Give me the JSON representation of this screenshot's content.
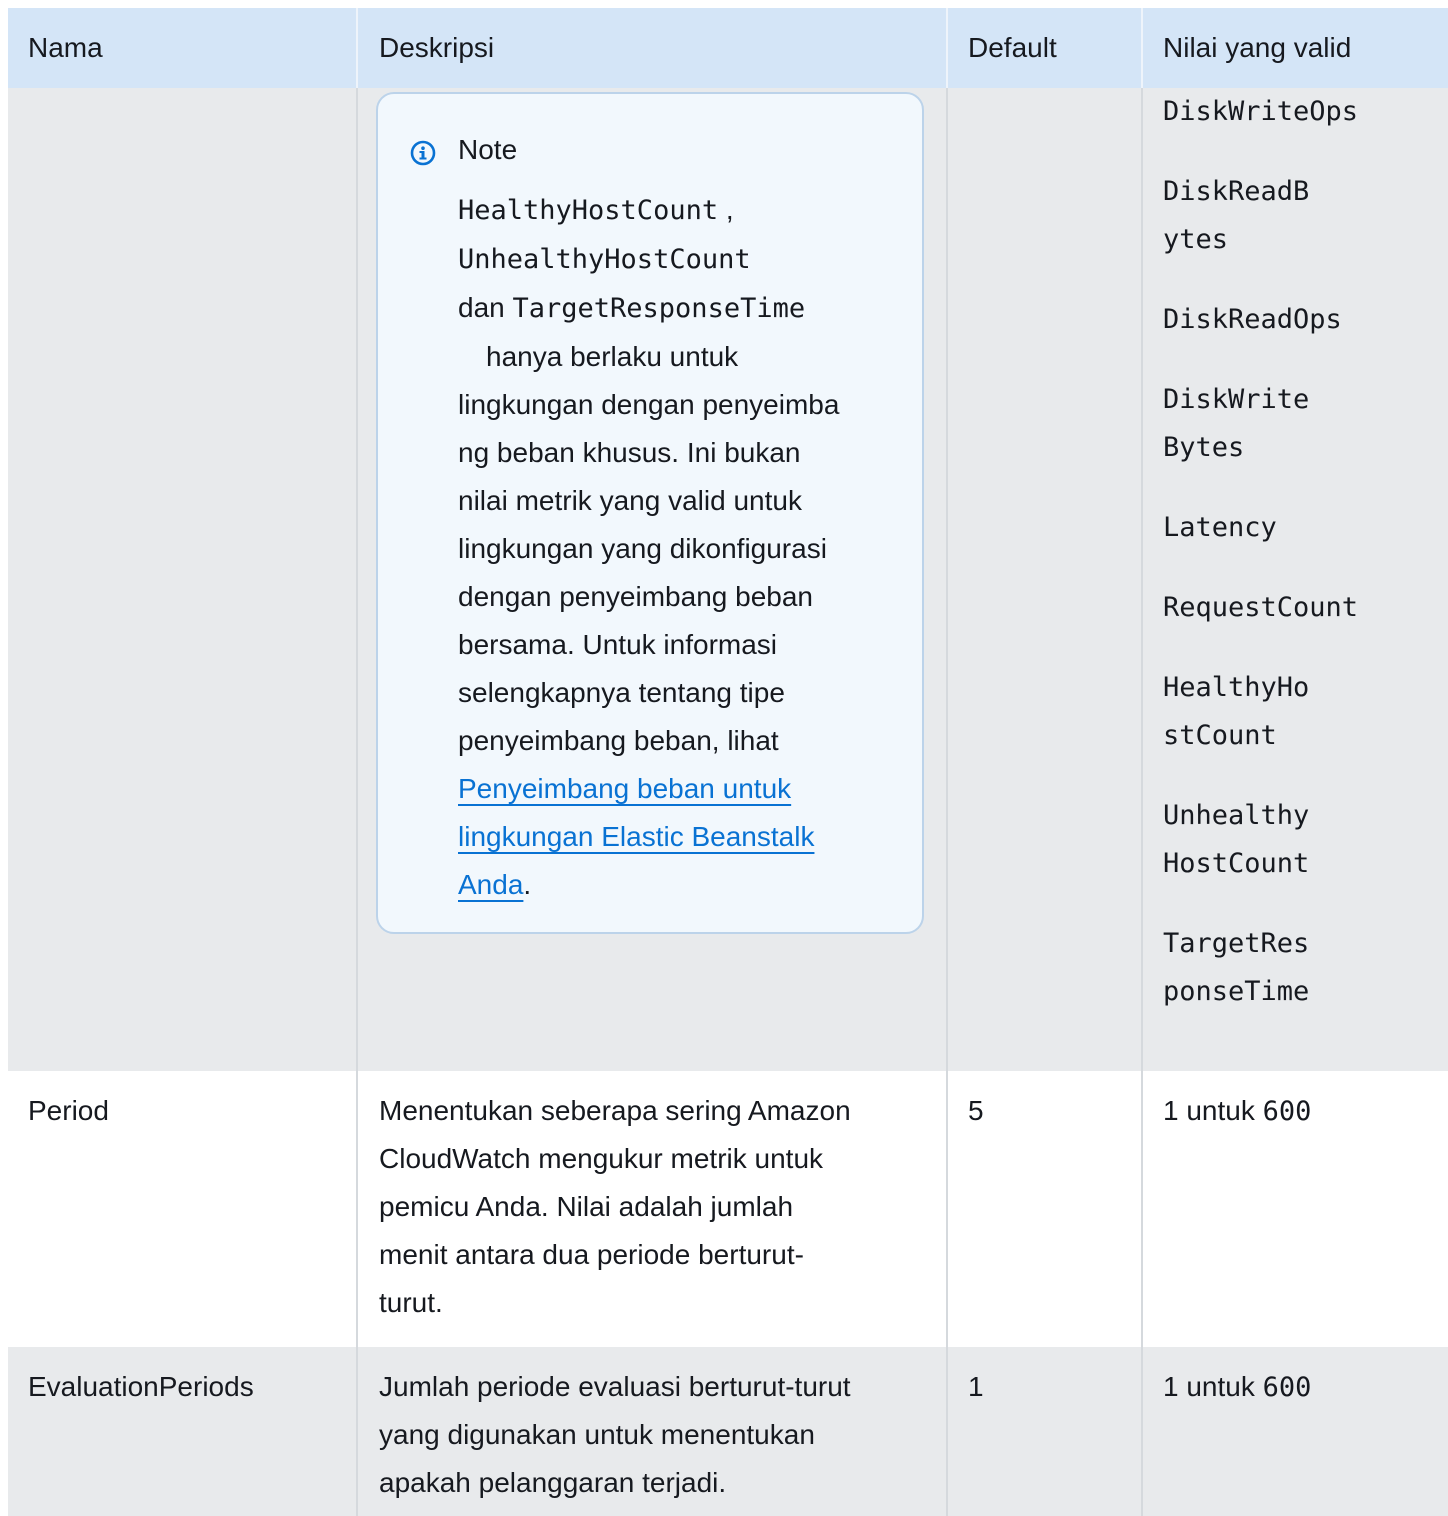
{
  "columns": {
    "name": "Nama",
    "description": "Deskripsi",
    "default": "Default",
    "valid": "Nilai yang valid"
  },
  "note": {
    "title": "Note",
    "code1": "HealthyHostCount",
    "sep1": " ,",
    "code2": "UnhealthyHostCount",
    "dan": "dan ",
    "code3": "TargetResponseTime",
    "lines": [
      "hanya berlaku untuk",
      "lingkungan dengan penyeimba",
      "ng beban khusus. Ini bukan",
      "nilai metrik yang valid untuk",
      "lingkungan yang dikonfigurasi",
      "dengan penyeimbang beban",
      "bersama. Untuk informasi",
      "selengkapnya tentang tipe",
      "penyeimbang beban, lihat"
    ],
    "link_lines": [
      "Penyeimbang beban untuk",
      "lingkungan Elastic Beanstalk",
      "Anda"
    ],
    "link_suffix": "."
  },
  "valid_values": [
    [
      "DiskWriteOps"
    ],
    [
      "DiskReadB",
      "ytes"
    ],
    [
      "DiskReadOps"
    ],
    [
      "DiskWrite",
      "Bytes"
    ],
    [
      "Latency"
    ],
    [
      "RequestCount"
    ],
    [
      "HealthyHo",
      "stCount"
    ],
    [
      "Unhealthy",
      "HostCount"
    ],
    [
      "TargetRes",
      "ponseTime"
    ]
  ],
  "rows": [
    {
      "name": "Period",
      "description_lines": [
        "Menentukan seberapa sering Amazon",
        "CloudWatch mengukur metrik untuk",
        "pemicu Anda. Nilai adalah jumlah",
        "menit antara dua periode berturut-",
        "turut."
      ],
      "default": "5",
      "valid_prefix": "1 untuk ",
      "valid_code": "600"
    },
    {
      "name": "EvaluationPeriods",
      "description_lines": [
        "Jumlah periode evaluasi berturut-turut",
        "yang digunakan untuk menentukan",
        "apakah pelanggaran terjadi."
      ],
      "default": "1",
      "valid_prefix": "1 untuk ",
      "valid_code": "600"
    }
  ],
  "colors": {
    "header_bg": "#d4e5f7",
    "row_grey": "#e8eaec",
    "note_bg": "#f2f8fd",
    "note_border": "#bcd3ea",
    "link": "#0972d3",
    "info_icon": "#0972d3"
  }
}
